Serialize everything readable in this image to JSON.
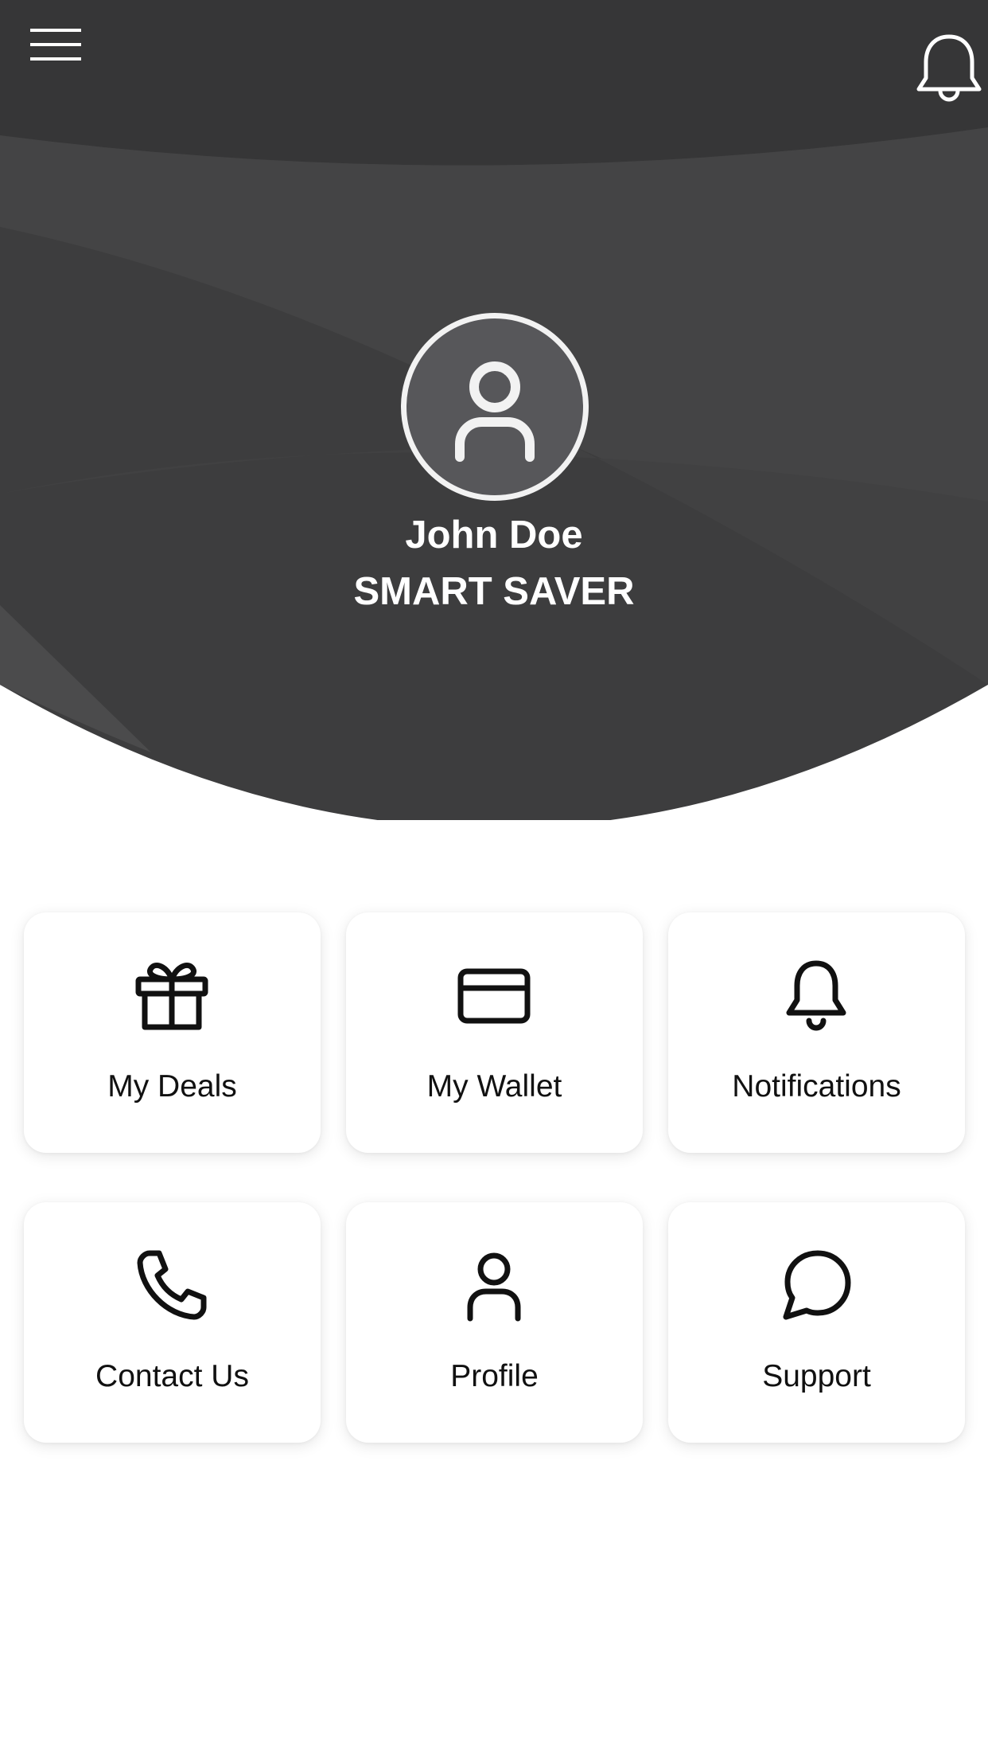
{
  "header": {
    "menu_icon": "hamburger-menu-icon",
    "notification_icon": "bell-icon",
    "background_color": "#3d3d3e"
  },
  "profile": {
    "avatar_icon": "user-avatar-icon",
    "name": "John Doe",
    "tier": "SMART SAVER"
  },
  "tiles": [
    {
      "label": "My Deals",
      "icon": "gift-icon"
    },
    {
      "label": "My Wallet",
      "icon": "credit-card-icon"
    },
    {
      "label": "Notifications",
      "icon": "bell-icon"
    },
    {
      "label": "Contact Us",
      "icon": "phone-icon"
    },
    {
      "label": "Profile",
      "icon": "user-icon"
    },
    {
      "label": "Support",
      "icon": "chat-bubble-icon"
    }
  ]
}
